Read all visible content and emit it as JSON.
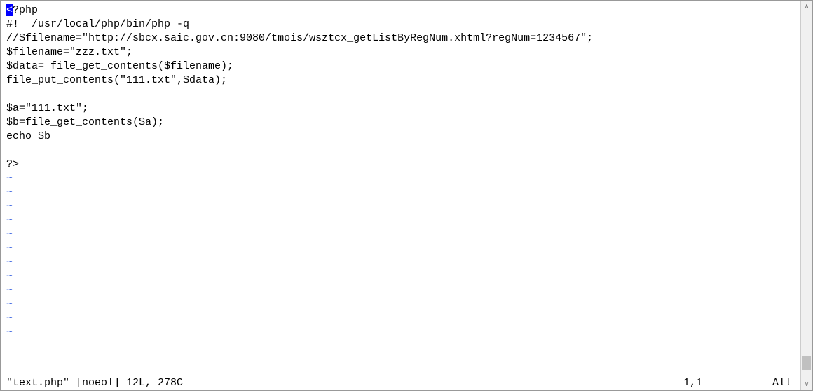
{
  "editor": {
    "cursor_char": "<",
    "lines": [
      "?php",
      "#!  /usr/local/php/bin/php -q",
      "//$filename=\"http://sbcx.saic.gov.cn:9080/tmois/wsztcx_getListByRegNum.xhtml?regNum=1234567\";",
      "$filename=\"zzz.txt\";",
      "$data= file_get_contents($filename);",
      "file_put_contents(\"111.txt\",$data);",
      "",
      "$a=\"111.txt\";",
      "$b=file_get_contents($a);",
      "echo $b",
      "",
      "?>"
    ],
    "tilde": "~",
    "tilde_count": 12
  },
  "status": {
    "file_info": "\"text.php\" [noeol] 12L, 278C",
    "cursor_position": "1,1",
    "scroll_percent": "All"
  },
  "scrollbar": {
    "up_arrow": "∧",
    "down_arrow": "∨"
  }
}
